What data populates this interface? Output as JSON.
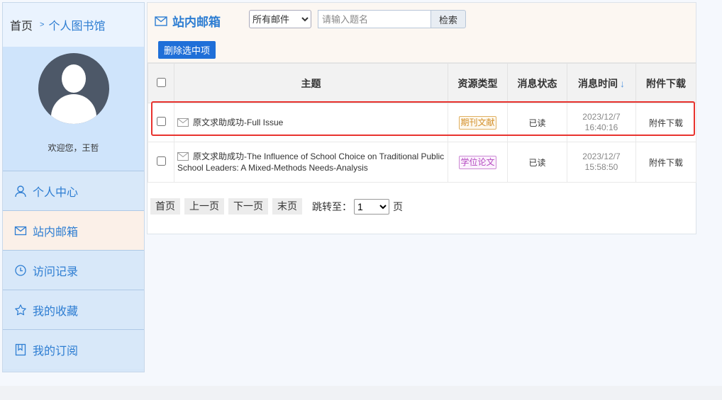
{
  "breadcrumb": {
    "home": "首页",
    "separator": ">",
    "current": "个人图书馆"
  },
  "profile": {
    "welcome": "欢迎您，王哲"
  },
  "sidebar": {
    "items": [
      {
        "label": "个人中心",
        "icon": "user-icon"
      },
      {
        "label": "站内邮箱",
        "icon": "mail-icon",
        "active": true
      },
      {
        "label": "访问记录",
        "icon": "clock-icon"
      },
      {
        "label": "我的收藏",
        "icon": "star-icon"
      },
      {
        "label": "我的订阅",
        "icon": "bookmark-icon"
      }
    ]
  },
  "toolbar": {
    "title": "站内邮箱",
    "folder_selected": "所有邮件",
    "search_placeholder": "请输入题名",
    "search_label": "检索",
    "delete_label": "删除选中项"
  },
  "table": {
    "headers": {
      "subject": "主题",
      "type": "资源类型",
      "status": "消息状态",
      "time": "消息时间",
      "attachment": "附件下载"
    },
    "sort_arrow": "↓",
    "rows": [
      {
        "subject": "原文求助成功-Full Issue",
        "type": "期刊文献",
        "status": "已读",
        "date": "2023/12/7",
        "clock": "16:40:16",
        "attachment": "附件下载"
      },
      {
        "subject": "原文求助成功-The Influence of School Choice on Traditional Public School Leaders: A Mixed-Methods Needs-Analysis",
        "type": "学位论文",
        "status": "已读",
        "date": "2023/12/7",
        "clock": "15:58:50",
        "attachment": "附件下载"
      }
    ]
  },
  "pager": {
    "first": "首页",
    "prev": "上一页",
    "next": "下一页",
    "last": "末页",
    "jump_label": "跳转至：",
    "page_value": "1",
    "page_unit": "页"
  },
  "colors": {
    "accent": "#2d7dd2",
    "highlight": "#e8332e",
    "journal_tag": "#d4902b",
    "thesis_tag": "#b54ac1"
  }
}
